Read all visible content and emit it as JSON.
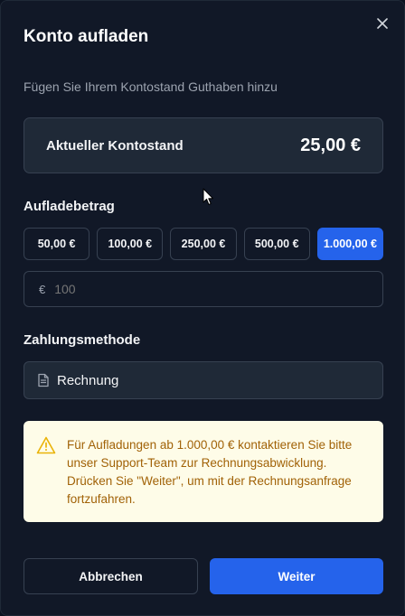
{
  "dialog": {
    "title": "Konto aufladen",
    "subtitle": "Fügen Sie Ihrem Kontostand Guthaben hinzu",
    "close_icon": "close-icon"
  },
  "balance": {
    "label": "Aktueller Kontostand",
    "value": "25,00 €"
  },
  "amount": {
    "section_label": "Aufladebetrag",
    "presets": [
      {
        "label": "50,00 €",
        "selected": false
      },
      {
        "label": "100,00 €",
        "selected": false
      },
      {
        "label": "250,00 €",
        "selected": false
      },
      {
        "label": "500,00 €",
        "selected": false
      },
      {
        "label": "1.000,00 €",
        "selected": true
      }
    ],
    "currency_symbol": "€",
    "input_placeholder": "100"
  },
  "payment": {
    "section_label": "Zahlungsmethode",
    "selected_method": "Rechnung",
    "method_icon": "document-icon"
  },
  "warning": {
    "icon": "warning-icon",
    "text": "Für Aufladungen ab 1.000,00 € kontaktieren Sie bitte unser Support-Team zur Rechnungsabwicklung. Drücken Sie \"Weiter\", um mit der Rechnungsanfrage fortzufahren."
  },
  "actions": {
    "cancel_label": "Abbrechen",
    "next_label": "Weiter"
  },
  "colors": {
    "accent": "#2563eb",
    "background": "#111827",
    "warning_bg": "#fefce8",
    "warning_text": "#a16207"
  }
}
